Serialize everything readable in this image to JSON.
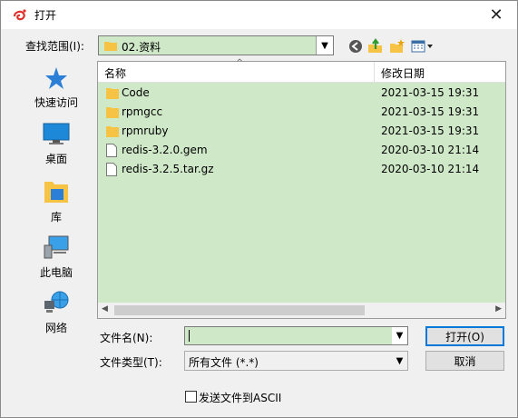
{
  "window": {
    "title": "打开",
    "close_glyph": "✕"
  },
  "lookin": {
    "label": "查找范围(I):",
    "value": "02.资料"
  },
  "places": [
    {
      "label": "快速访问",
      "icon": "star-icon"
    },
    {
      "label": "桌面",
      "icon": "desktop-icon"
    },
    {
      "label": "库",
      "icon": "library-icon"
    },
    {
      "label": "此电脑",
      "icon": "computer-icon"
    },
    {
      "label": "网络",
      "icon": "network-icon"
    }
  ],
  "list": {
    "col_name": "名称",
    "col_date": "修改日期",
    "rows": [
      {
        "name": "Code",
        "date": "2021-03-15 19:31",
        "type": "folder"
      },
      {
        "name": "rpmgcc",
        "date": "2021-03-15 19:31",
        "type": "folder"
      },
      {
        "name": "rpmruby",
        "date": "2021-03-15 19:31",
        "type": "folder"
      },
      {
        "name": "redis-3.2.0.gem",
        "date": "2020-03-10 21:14",
        "type": "file"
      },
      {
        "name": "redis-3.2.5.tar.gz",
        "date": "2020-03-10 21:14",
        "type": "file"
      }
    ]
  },
  "filename": {
    "label": "文件名(N):",
    "value": ""
  },
  "filetype": {
    "label": "文件类型(T):",
    "value": "所有文件 (*.*)"
  },
  "buttons": {
    "open": "打开(O)",
    "cancel": "取消"
  },
  "ascii_checkbox": {
    "label": "发送文件到ASCII",
    "checked": false
  },
  "colors": {
    "accent": "#0078d7",
    "list_bg": "#cfe8c8",
    "folder": "#f6c344"
  }
}
